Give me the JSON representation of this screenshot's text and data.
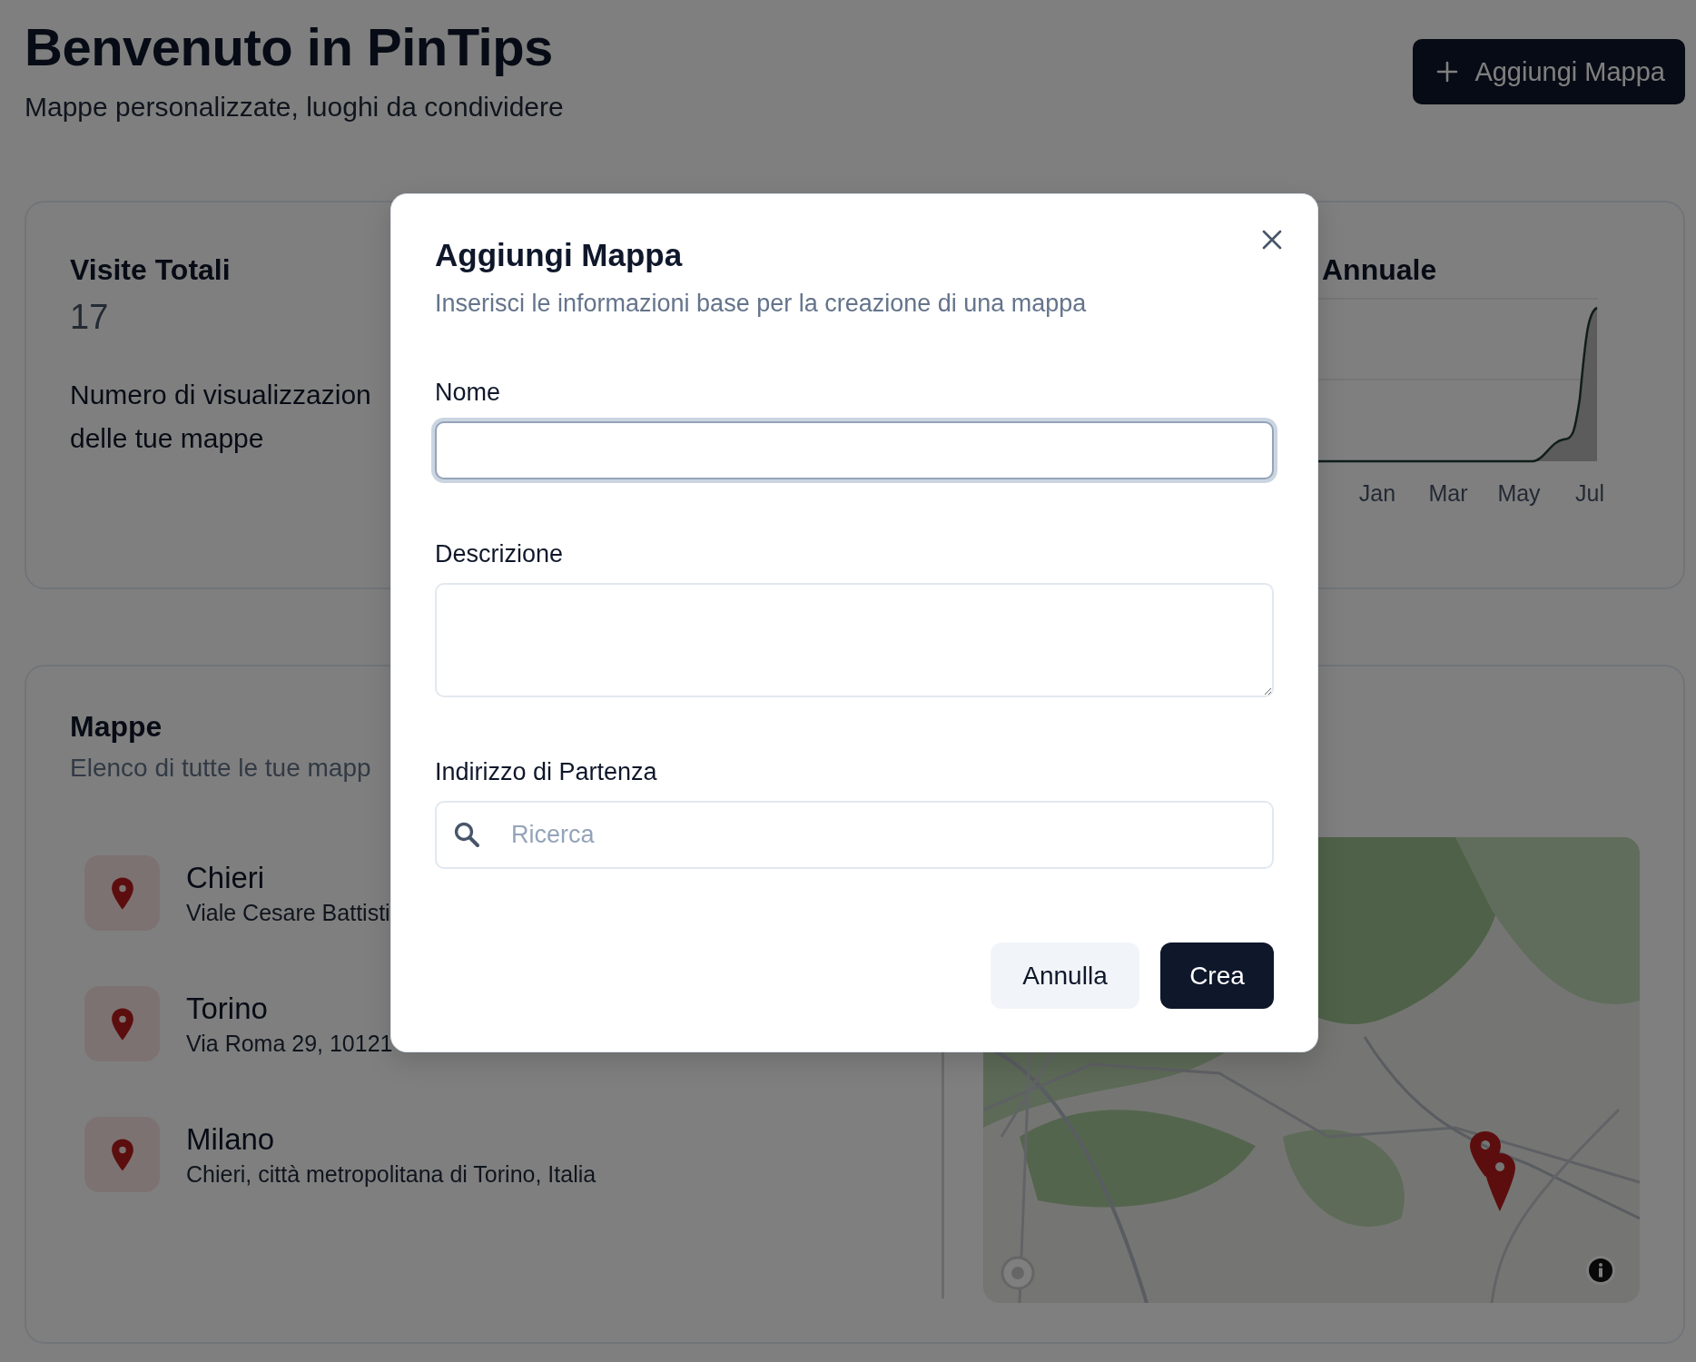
{
  "header": {
    "title": "Benvenuto in PinTips",
    "subtitle": "Mappe personalizzate, luoghi da condividere",
    "add_button": "Aggiungi Mappa"
  },
  "stats_card": {
    "title": "Visite Totali",
    "value": "17",
    "description": "Numero di visualizzazion delle tue mappe"
  },
  "chart_card": {
    "title": "Annuale",
    "x_labels": [
      "Jan",
      "Mar",
      "May",
      "Jul"
    ]
  },
  "maps_card": {
    "title": "Mappe",
    "subtitle": "Elenco di tutte le tue mapp",
    "items": [
      {
        "name": "Chieri",
        "address": "Viale Cesare Battisti"
      },
      {
        "name": "Torino",
        "address": "Via Roma 29, 10121"
      },
      {
        "name": "Milano",
        "address": "Chieri, città metropolitana di Torino, Italia"
      }
    ]
  },
  "modal": {
    "title": "Aggiungi Mappa",
    "subtitle": "Inserisci le informazioni base per la creazione di una mappa",
    "fields": [
      {
        "kind": "text",
        "label": "Nome",
        "focused": true
      },
      {
        "kind": "textarea",
        "label": "Descrizione",
        "focused": false
      },
      {
        "kind": "search",
        "label": "Indirizzo di Partenza",
        "placeholder": "Ricerca",
        "focused": false
      }
    ],
    "buttons": [
      {
        "kind": "secondary",
        "label": "Annulla"
      },
      {
        "kind": "primary",
        "label": "Crea"
      }
    ]
  }
}
